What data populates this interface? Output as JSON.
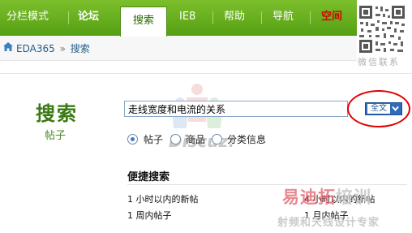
{
  "nav": {
    "items": [
      {
        "label": "分栏模式"
      },
      {
        "label": "论坛"
      },
      {
        "label": "搜索"
      },
      {
        "label": "IE8"
      },
      {
        "label": "帮助"
      },
      {
        "label": "导航"
      },
      {
        "label": "空间"
      }
    ]
  },
  "qr": {
    "caption": "微信联系"
  },
  "breadcrumb": {
    "home": "EDA365",
    "separator": "»",
    "current": "搜索"
  },
  "search": {
    "title": "搜索",
    "subtitle": "帖子",
    "query": "走线宽度和电流的关系",
    "scope": "全文",
    "options": [
      {
        "label": "帖子",
        "selected": true
      },
      {
        "label": "商品",
        "selected": false
      },
      {
        "label": "分类信息",
        "selected": false
      }
    ]
  },
  "quick": {
    "title": "便捷搜索",
    "links": [
      "1 小时以内的新帖",
      "4 小时以内的新帖",
      "1 周内帖子",
      "1 月内帖子"
    ]
  },
  "watermark": {
    "discuz": "Discuz!",
    "brand_part1": "易迪拓",
    "brand_part2": "培训",
    "slogan": "射频和天线设计专家"
  },
  "colors": {
    "nav_green": "#66aa1e",
    "title_green": "#3a7a12",
    "link_blue": "#215f8b",
    "highlight_red": "#e00000"
  }
}
